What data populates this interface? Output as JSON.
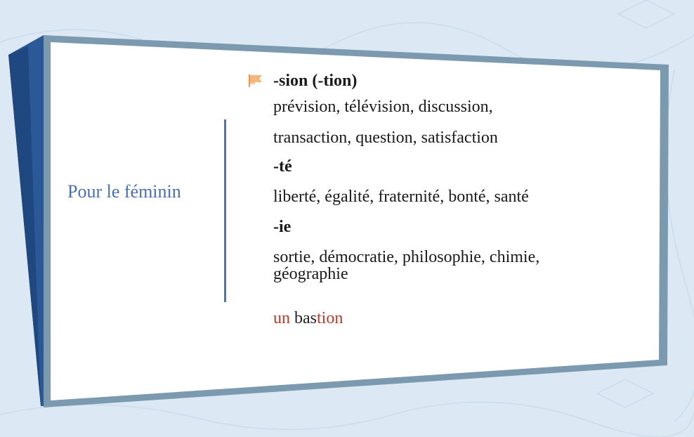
{
  "left_label": "Pour le féminin",
  "sections": [
    {
      "suffix": "-sion (-tion)",
      "examples": [
        "prévision, télévision, discussion,",
        "transaction, question, satisfaction"
      ]
    },
    {
      "suffix": "-té",
      "examples": [
        "liberté, égalité, fraternité, bonté, santé"
      ]
    },
    {
      "suffix": "-ie",
      "examples": [
        "sortie, démocratie, philosophie, chimie,",
        "géographie"
      ]
    }
  ],
  "word_example": {
    "part1": "un",
    "part2": "bas",
    "part3": "tion"
  },
  "colors": {
    "accent_blue": "#4a6fb0",
    "red": "#b83a28",
    "flag": "#f0a35a"
  },
  "icons": {
    "bullet": "flag-icon"
  }
}
